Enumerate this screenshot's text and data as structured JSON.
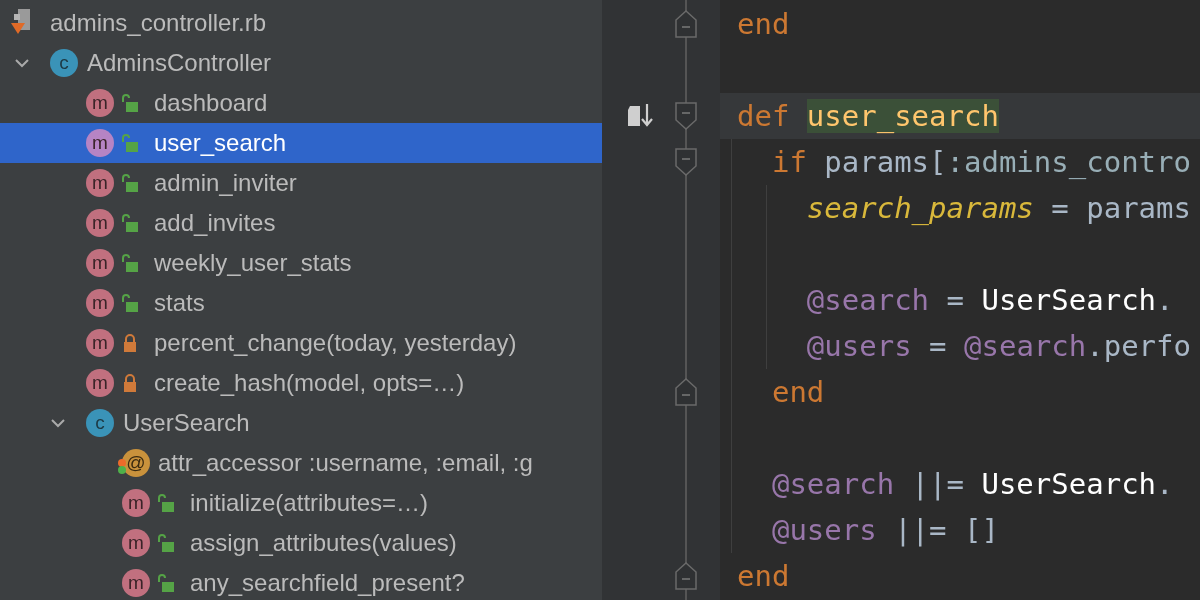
{
  "structure_panel": {
    "tree": [
      {
        "kind": "file",
        "label": "admins_controller.rb",
        "selected": false,
        "children": [
          {
            "kind": "class",
            "badge": "c",
            "label": "AdminsController",
            "expanded": true,
            "selected": false,
            "children": [
              {
                "kind": "method",
                "badge": "m",
                "private": false,
                "label": "dashboard",
                "selected": false
              },
              {
                "kind": "method",
                "badge": "m",
                "private": false,
                "label": "user_search",
                "selected": true
              },
              {
                "kind": "method",
                "badge": "m",
                "private": false,
                "label": "admin_inviter",
                "selected": false
              },
              {
                "kind": "method",
                "badge": "m",
                "private": false,
                "label": "add_invites",
                "selected": false
              },
              {
                "kind": "method",
                "badge": "m",
                "private": false,
                "label": "weekly_user_stats",
                "selected": false
              },
              {
                "kind": "method",
                "badge": "m",
                "private": false,
                "label": "stats",
                "selected": false
              },
              {
                "kind": "method",
                "badge": "m",
                "private": true,
                "label": "percent_change(today, yesterday)",
                "selected": false
              },
              {
                "kind": "method",
                "badge": "m",
                "private": true,
                "label": "create_hash(model, opts=…)",
                "selected": false
              },
              {
                "kind": "class",
                "badge": "c",
                "label": "UserSearch",
                "expanded": true,
                "selected": false,
                "children": [
                  {
                    "kind": "attribute",
                    "badge": "@",
                    "label": "attr_accessor :username, :email, :g",
                    "selected": false
                  },
                  {
                    "kind": "method",
                    "badge": "m",
                    "private": false,
                    "label": "initialize(attributes=…)",
                    "selected": false
                  },
                  {
                    "kind": "method",
                    "badge": "m",
                    "private": false,
                    "label": "assign_attributes(values)",
                    "selected": false
                  },
                  {
                    "kind": "method",
                    "badge": "m",
                    "private": false,
                    "label": "any_searchfield_present?",
                    "selected": false
                  }
                ]
              }
            ]
          }
        ]
      }
    ]
  },
  "editor": {
    "lines": [
      {
        "fold_start": false,
        "fold_end": true,
        "current": false,
        "tokens": [
          {
            "kind": "keyword",
            "text": "end"
          }
        ]
      },
      {
        "current": false
      },
      {
        "fold_start": true,
        "fold_end": false,
        "gutter_marker": true,
        "current": true,
        "tokens": [
          {
            "kind": "keyword",
            "text": "def "
          },
          {
            "kind": "function",
            "text": "user_search",
            "highlighted": true
          }
        ]
      },
      {
        "fold_start": true,
        "fold_end": false,
        "current": false,
        "tokens": [
          {
            "kind": "keyword",
            "text": "  if "
          },
          {
            "kind": "ident",
            "text": "params["
          },
          {
            "kind": "symbol",
            "text": ":admins_contro"
          }
        ]
      },
      {
        "current": false,
        "tokens": [
          {
            "kind": "local",
            "text": "    search_params"
          },
          {
            "kind": "ident",
            "text": " = params"
          }
        ]
      },
      {
        "current": false
      },
      {
        "current": false,
        "tokens": [
          {
            "kind": "ivar",
            "text": "    @search"
          },
          {
            "kind": "ident",
            "text": " = "
          },
          {
            "kind": "constant",
            "text": "UserSearch"
          },
          {
            "kind": "ident",
            "text": "."
          }
        ]
      },
      {
        "current": false,
        "tokens": [
          {
            "kind": "ivar",
            "text": "    @users"
          },
          {
            "kind": "ident",
            "text": " = "
          },
          {
            "kind": "ivar",
            "text": "@search"
          },
          {
            "kind": "ident",
            "text": ".perfo"
          }
        ]
      },
      {
        "fold_start": false,
        "fold_end": true,
        "current": false,
        "tokens": [
          {
            "kind": "keyword",
            "text": "  end"
          }
        ]
      },
      {
        "current": false
      },
      {
        "current": false,
        "tokens": [
          {
            "kind": "ivar",
            "text": "  @search"
          },
          {
            "kind": "ident",
            "text": " ||= "
          },
          {
            "kind": "constant",
            "text": "UserSearch"
          },
          {
            "kind": "ident",
            "text": "."
          }
        ]
      },
      {
        "current": false,
        "tokens": [
          {
            "kind": "ivar",
            "text": "  @users"
          },
          {
            "kind": "ident",
            "text": " ||= []"
          }
        ]
      },
      {
        "fold_start": false,
        "fold_end": true,
        "current": false,
        "tokens": [
          {
            "kind": "keyword",
            "text": "end"
          }
        ]
      }
    ]
  }
}
